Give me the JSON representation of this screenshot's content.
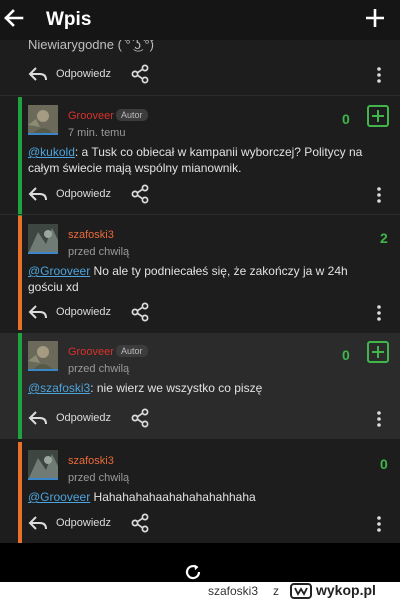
{
  "header": {
    "title": "Wpis"
  },
  "previous_comment": {
    "text_tail": "Niewiarygodne ( ͡° ͜ʖ ͡°)"
  },
  "actions": {
    "reply_label": "Odpowiedz"
  },
  "comments": [
    {
      "author": "Grooveer",
      "badge": "Autor",
      "time": "7 min. temu",
      "mention": "@kukold",
      "text": ": a Tusk co obiecał w kampanii wyborczej? Politycy na całym świecie mają wspólny mianownik.",
      "score": "0",
      "thread_color": "#1fa340"
    },
    {
      "author": "szafoski3",
      "time": "przed chwilą",
      "mention": "@Grooveer",
      "text": " No ale ty podniecałeś się, że zakończy ja w 24h gościu xd",
      "score": "2",
      "thread_color": "#e8702a"
    },
    {
      "author": "Grooveer",
      "badge": "Autor",
      "time": "przed chwilą",
      "mention": "@szafoski3",
      "text": ": nie wierz we wszystko co piszę",
      "score": "0",
      "thread_color": "#1fa340"
    },
    {
      "author": "szafoski3",
      "time": "przed chwilą",
      "mention": "@Grooveer",
      "text": " Hahahahahaahahahahahhaha",
      "score": "0",
      "thread_color": "#e8702a"
    }
  ],
  "watermark": {
    "user": "szafoski3",
    "separator": "z",
    "site": "wykop.pl"
  },
  "colors": {
    "plus_green": "#3fb54a",
    "mention_blue": "#4da3dc",
    "author_red": "#d8322c",
    "author_orange": "#ea6a3a"
  },
  "icons": [
    "arrow-left-icon",
    "plus-icon",
    "reply-icon",
    "share-icon",
    "more-vertical-icon",
    "vote-plus-icon",
    "refresh-icon",
    "wykop-logo-icon"
  ]
}
